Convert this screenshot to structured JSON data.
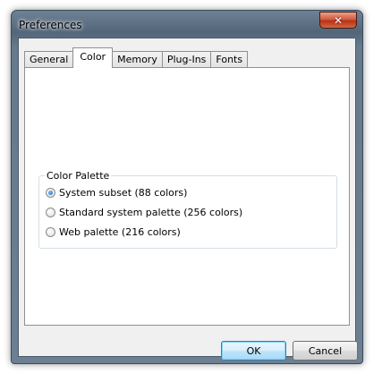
{
  "window": {
    "title": "Preferences"
  },
  "tabs": [
    {
      "label": "General",
      "selected": false
    },
    {
      "label": "Color",
      "selected": true
    },
    {
      "label": "Memory",
      "selected": false
    },
    {
      "label": "Plug-Ins",
      "selected": false
    },
    {
      "label": "Fonts",
      "selected": false
    }
  ],
  "color_palette": {
    "group_label": "Color Palette",
    "options": [
      {
        "label": "System subset (88 colors)",
        "checked": true
      },
      {
        "label": "Standard system palette (256 colors)",
        "checked": false
      },
      {
        "label": "Web palette (216 colors)",
        "checked": false
      }
    ]
  },
  "buttons": {
    "ok_label": "OK",
    "cancel_label": "Cancel"
  },
  "colors": {
    "accent_default_button": "#3c7fb1",
    "close_button": "#c8442a"
  }
}
